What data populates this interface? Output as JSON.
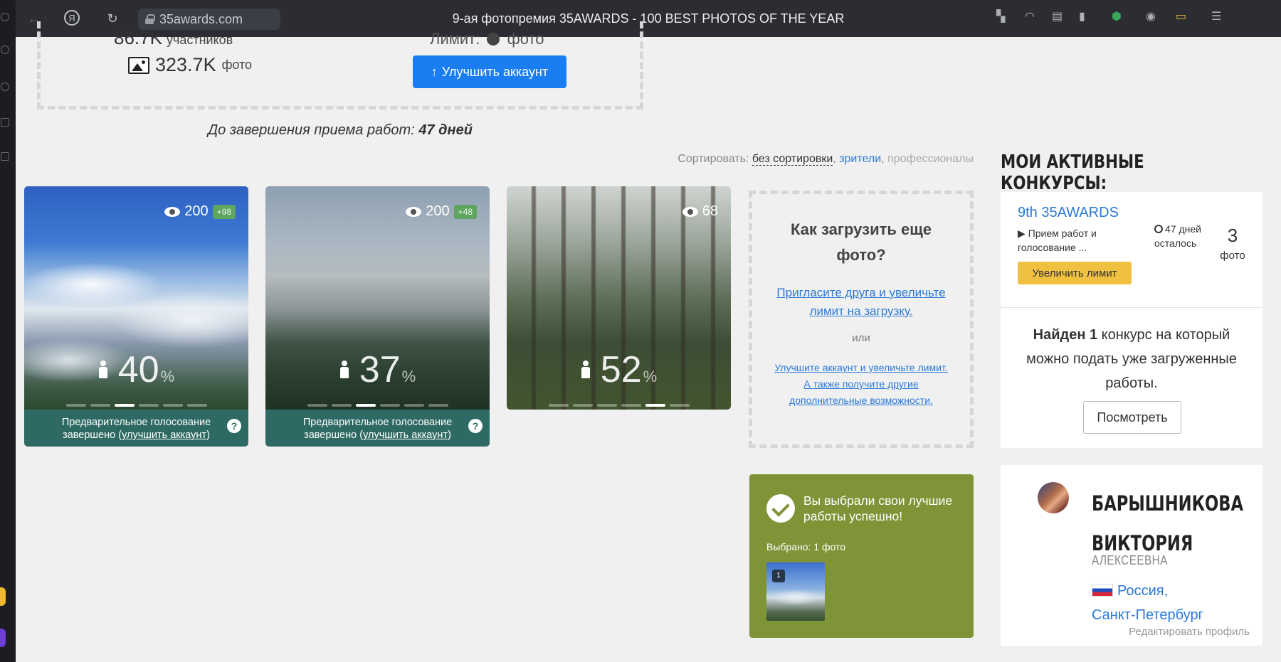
{
  "browser": {
    "url": "35awards.com",
    "title": "9-ая фотопремия 35AWARDS - 100 BEST PHOTOS OF THE YEAR"
  },
  "profile_stats": {
    "participants_count": "86.7K",
    "participants_label": "участников",
    "photos_count": "323.7K",
    "photos_label": "фото",
    "limit_label": "Лимит:",
    "limit_unit": "фото",
    "upgrade_button": "Улучшить аккаунт"
  },
  "deadline": {
    "label": "До завершения приема работ:",
    "value": "47 дней"
  },
  "sort": {
    "label": "Сортировать:",
    "options": [
      "без сортировки",
      "зрители",
      "профессионалы"
    ],
    "sep": ","
  },
  "photos": [
    {
      "views": "200",
      "new_views": "+98",
      "percent": "40",
      "active_dot": 2,
      "vote_text": "Предварительное голосование",
      "vote_text2": "завершено (",
      "vote_link": "улучшить аккаунт",
      "vote_end": ")"
    },
    {
      "views": "200",
      "new_views": "+48",
      "percent": "37",
      "active_dot": 2,
      "vote_text": "Предварительное голосование",
      "vote_text2": "завершено (",
      "vote_link": "улучшить аккаунт",
      "vote_end": ")"
    },
    {
      "views": "68",
      "new_views": "",
      "percent": "52",
      "active_dot": 4
    }
  ],
  "percent_sign": "%",
  "upload_box": {
    "title": "Как загрузить еще фото?",
    "invite_link": "Пригласите друга и увеличьте лимит на загрузку.",
    "or": "или",
    "upgrade_link": "Улучшите аккаунт и увеличьте лимит. А также получите другие дополнительные возможности."
  },
  "success": {
    "message": "Вы выбрали свои лучшие работы успешно!",
    "selected": "Выбрано: 1 фото",
    "thumb_number": "1"
  },
  "active_contests": {
    "title": "МОИ АКТИВНЫЕ КОНКУРСЫ:",
    "contest_name": "9th 35AWARDS",
    "stage": "▶ Прием работ и голосование ...",
    "days_left": "47 дней осталось",
    "photos_count": "3",
    "photos_label": "фото",
    "limit_button": "Увеличить лимит",
    "found_bold": "Найден 1",
    "found_text": " конкурс на который можно подать уже загруженные работы.",
    "view_button": "Посмотреть"
  },
  "user": {
    "name": "БАРЫШНИКОВА ВИКТОРИЯ",
    "middle_name": "АЛЕКСЕЕВНА",
    "country": "Россия,",
    "city": "Санкт-Петербург",
    "edit": "Редактировать профиль"
  }
}
